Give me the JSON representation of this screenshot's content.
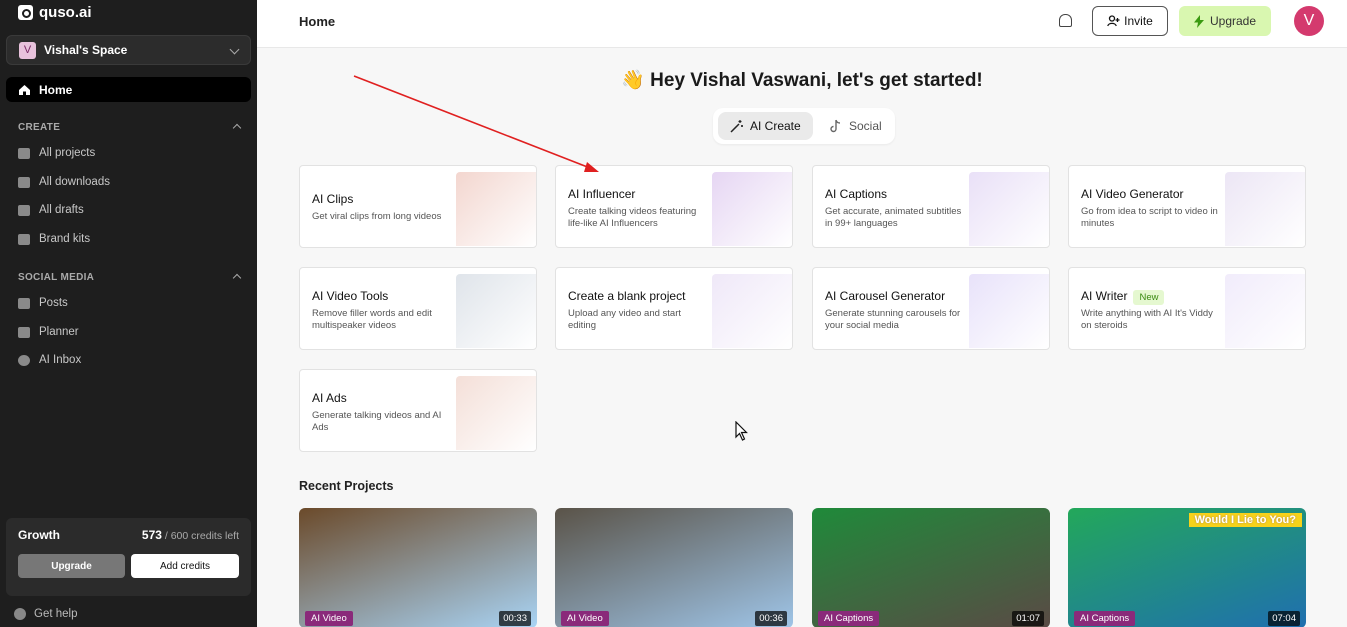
{
  "sidebar": {
    "brand": "quso.ai",
    "space": {
      "initial": "V",
      "name": "Vishal's Space"
    },
    "home_label": "Home",
    "create_section": "CREATE",
    "create_items": [
      "All projects",
      "All downloads",
      "All drafts",
      "Brand kits"
    ],
    "social_section": "SOCIAL MEDIA",
    "social_items": [
      "Posts",
      "Planner",
      "AI Inbox"
    ],
    "growth": {
      "plan": "Growth",
      "credits_used": "573",
      "credits_rest": "/ 600 credits left",
      "upgrade_label": "Upgrade",
      "add_label": "Add credits"
    },
    "help_label": "Get help"
  },
  "header": {
    "title": "Home",
    "invite_label": "Invite",
    "upgrade_label": "Upgrade",
    "avatar_initial": "V"
  },
  "main": {
    "greeting_emoji": "👋",
    "greeting": "Hey Vishal Vaswani, let's get started!",
    "tabs": [
      "AI Create",
      "Social"
    ],
    "tools": [
      {
        "title": "AI Clips",
        "desc": "Get viral clips from long videos",
        "thumb": "#f3d6cf"
      },
      {
        "title": "AI Influencer",
        "desc": "Create talking videos featuring life-like AI Influencers",
        "thumb": "#e6d6f3"
      },
      {
        "title": "AI Captions",
        "desc": "Get accurate, animated subtitles in 99+ languages",
        "thumb": "#e9e0f7"
      },
      {
        "title": "AI Video Generator",
        "desc": "Go from idea to script to video in minutes",
        "thumb": "#ece6f5"
      },
      {
        "title": "AI Video Tools",
        "desc": "Remove filler words and edit multispeaker videos",
        "thumb": "#dfe4ea"
      },
      {
        "title": "Create a blank project",
        "desc": "Upload any video and start editing",
        "thumb": "#efe8f8"
      },
      {
        "title": "AI Carousel Generator",
        "desc": "Generate stunning carousels for your social media",
        "thumb": "#e8e2fa"
      },
      {
        "title": "AI Writer",
        "desc": "Write anything with AI It's Viddy on steroids",
        "badge": "New",
        "thumb": "#f1ecfb"
      },
      {
        "title": "AI Ads",
        "desc": "Generate talking videos and AI Ads",
        "thumb": "#f4dfd8"
      }
    ],
    "recent_title": "Recent Projects",
    "projects": [
      {
        "tag": "AI Video",
        "duration": "00:33",
        "color_a": "#6b4a2a",
        "color_b": "#a9d4f5"
      },
      {
        "tag": "AI Video",
        "duration": "00:36",
        "color_a": "#5a5348",
        "color_b": "#9fc5e8"
      },
      {
        "tag": "AI Captions",
        "duration": "01:07",
        "color_a": "#1f8a3a",
        "color_b": "#5a4a45"
      },
      {
        "tag": "AI Captions",
        "duration": "07:04",
        "color_a": "#23a85a",
        "color_b": "#1f6fb0",
        "overlay": "Would I Lie to You?"
      }
    ]
  }
}
